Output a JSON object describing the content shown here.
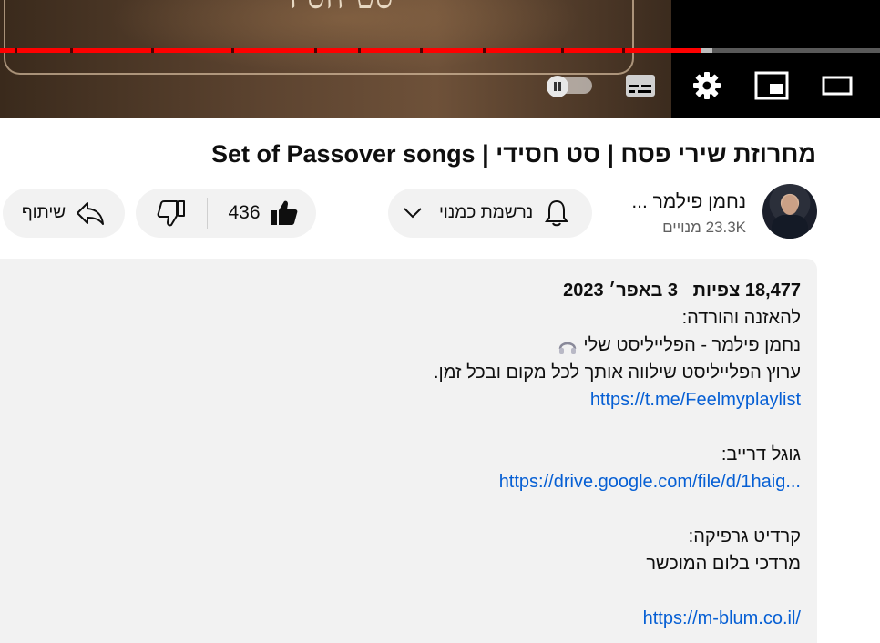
{
  "player": {
    "overlay_text": "סט חסידי",
    "progress_percent": 79.6,
    "loaded_percent": 81,
    "accent": "#ff0000",
    "controls": [
      "autoplay-toggle",
      "subtitles-icon",
      "settings-icon",
      "miniplayer-icon",
      "theater-mode-icon"
    ]
  },
  "video": {
    "title": "מחרוזת שירי פסח | סט חסידי | Set of Passover songs"
  },
  "channel": {
    "name": "נחמן פילמר ...",
    "subscribers": "23.3K מנויים"
  },
  "actions": {
    "subscribed_label": "נרשמת כמנוי",
    "like_count": "436",
    "share_label": "שיתוף"
  },
  "description": {
    "views": "18,477 צפיות",
    "date": "3 באפר׳ 2023",
    "lines": [
      {
        "text": "להאזנה והורדה:",
        "type": "text"
      },
      {
        "text": "נחמן פילמר - הפלייליסט שלי",
        "type": "text-headphones"
      },
      {
        "text": "ערוץ הפלייליסט שילווה אותך לכל מקום ובכל זמן.",
        "type": "text"
      },
      {
        "text": "https://t.me/Feelmyplaylist",
        "type": "link"
      },
      {
        "text": "",
        "type": "blank"
      },
      {
        "text": "גוגל דרייב:",
        "type": "text"
      },
      {
        "text": "https://drive.google.com/file/d/1haig...",
        "type": "link"
      },
      {
        "text": "",
        "type": "blank"
      },
      {
        "text": "קרדיט גרפיקה:",
        "type": "text"
      },
      {
        "text": "מרדכי בלום המוכשר",
        "type": "text"
      },
      {
        "text": "",
        "type": "blank"
      },
      {
        "text": "https://m-blum.co.il/",
        "type": "link"
      }
    ]
  }
}
